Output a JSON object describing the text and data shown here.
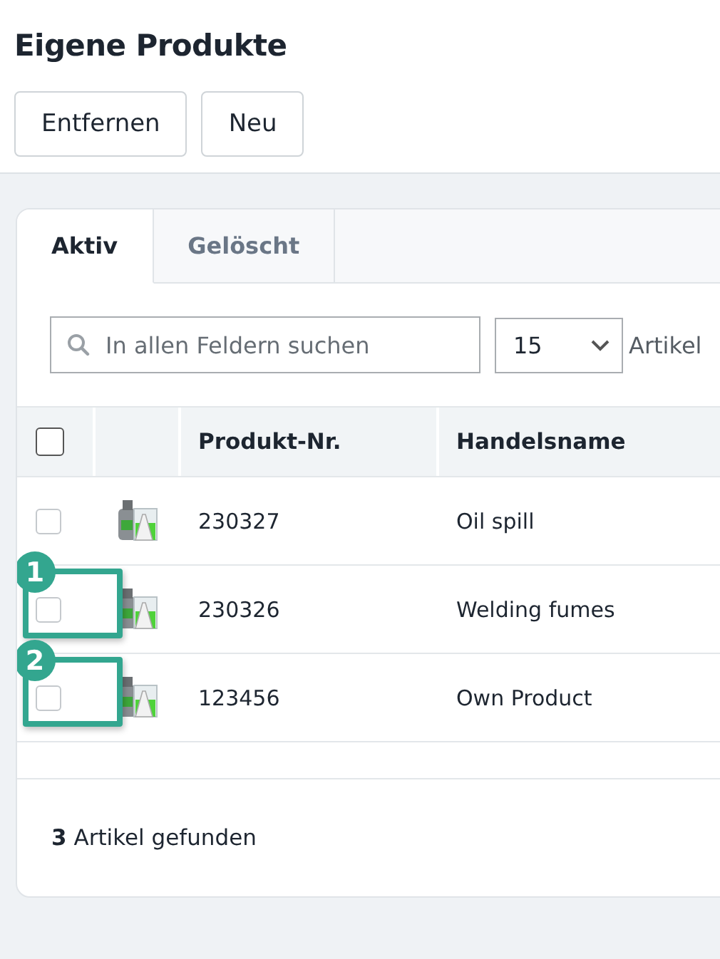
{
  "page_title": "Eigene Produkte",
  "toolbar_buttons": [
    "Entfernen",
    "Neu"
  ],
  "tabs": [
    {
      "label": "Aktiv",
      "selected": true
    },
    {
      "label": "Gelöscht",
      "selected": false
    }
  ],
  "search": {
    "placeholder": "In allen Feldern suchen"
  },
  "page_size": {
    "value": "15",
    "label": "Artikel"
  },
  "table": {
    "select_all": {
      "checked": false
    },
    "columns": [
      "Produkt-Nr.",
      "Handelsname"
    ],
    "rows": [
      {
        "checked": false,
        "number": "230327",
        "name": "Oil spill"
      },
      {
        "checked": false,
        "number": "230326",
        "name": "Welding fumes",
        "callout": "1"
      },
      {
        "checked": false,
        "number": "123456",
        "name": "Own Product",
        "callout": "2"
      }
    ]
  },
  "result_count": "**3** Artikel gefunden"
}
